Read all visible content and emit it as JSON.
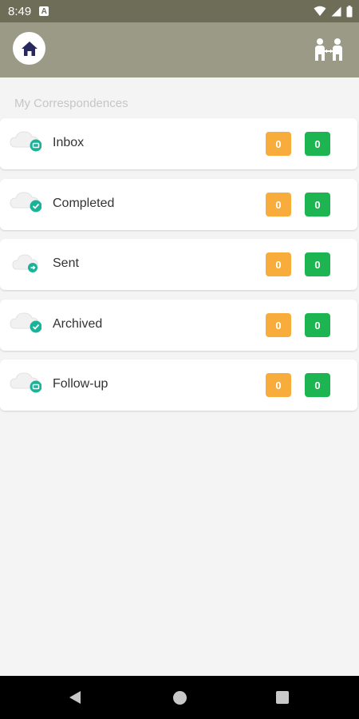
{
  "status_bar": {
    "time": "8:49",
    "notification_icon": "A",
    "icons": [
      "wifi-icon",
      "signal-icon",
      "battery-icon"
    ]
  },
  "app_bar": {
    "left_icon": "home-icon",
    "right_icon": "delegation-icon"
  },
  "section": {
    "title": "My Correspondences"
  },
  "items": [
    {
      "label": "Inbox",
      "icon": "inbox-cloud-icon",
      "count_orange": "0",
      "count_green": "0"
    },
    {
      "label": "Completed",
      "icon": "completed-cloud-icon",
      "count_orange": "0",
      "count_green": "0"
    },
    {
      "label": "Sent",
      "icon": "sent-cloud-icon",
      "count_orange": "0",
      "count_green": "0"
    },
    {
      "label": "Archived",
      "icon": "archived-cloud-icon",
      "count_orange": "0",
      "count_green": "0"
    },
    {
      "label": "Follow-up",
      "icon": "followup-cloud-icon",
      "count_orange": "0",
      "count_green": "0"
    }
  ],
  "colors": {
    "status_bar": "#6e6d58",
    "app_bar": "#9a9a86",
    "badge_orange": "#f7ac3b",
    "badge_green": "#1db552",
    "icon_teal": "#19b39a",
    "home_icon": "#27295e"
  },
  "nav_bar": {
    "icons": [
      "back-icon",
      "home-circle-icon",
      "recents-icon"
    ]
  }
}
